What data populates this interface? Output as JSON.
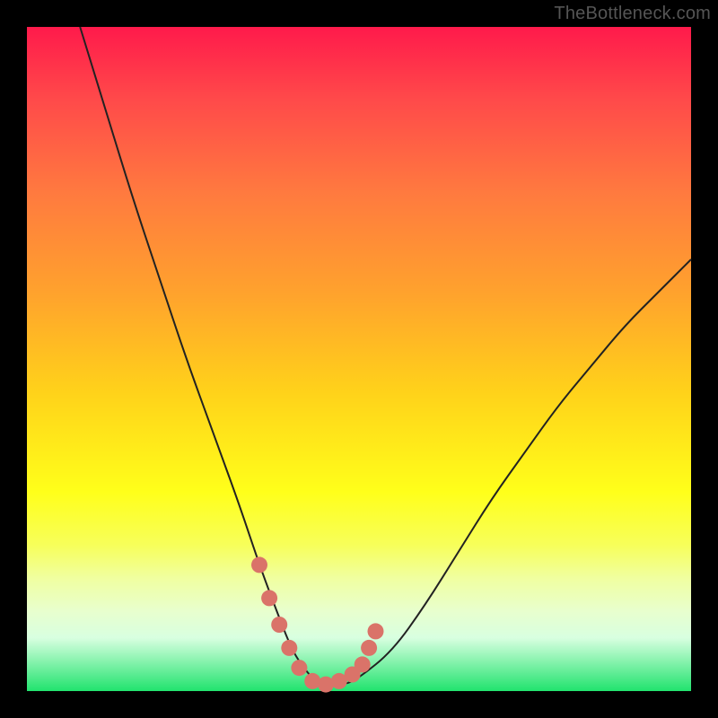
{
  "watermark": "TheBottleneck.com",
  "chart_data": {
    "type": "line",
    "title": "",
    "xlabel": "",
    "ylabel": "",
    "xlim": [
      0,
      100
    ],
    "ylim": [
      0,
      100
    ],
    "series": [
      {
        "name": "bottleneck-curve",
        "x": [
          8,
          12,
          16,
          20,
          24,
          28,
          32,
          35,
          38,
          40,
          42,
          44,
          46,
          48,
          50,
          55,
          60,
          65,
          70,
          75,
          80,
          85,
          90,
          95,
          100
        ],
        "values": [
          100,
          87,
          74,
          62,
          50,
          39,
          28,
          19,
          11,
          6,
          3,
          1,
          1,
          1,
          2,
          6,
          13,
          21,
          29,
          36,
          43,
          49,
          55,
          60,
          65
        ]
      }
    ],
    "markers": {
      "name": "highlight-region",
      "color": "#da7369",
      "x": [
        35,
        36.5,
        38,
        39.5,
        41,
        43,
        45,
        47,
        49,
        50.5,
        51.5,
        52.5
      ],
      "values": [
        19,
        14,
        10,
        6.5,
        3.5,
        1.5,
        1,
        1.5,
        2.5,
        4,
        6.5,
        9
      ]
    },
    "heatmap_note": "background gradient encodes bottleneck severity: red=high at top, green=low at bottom"
  }
}
